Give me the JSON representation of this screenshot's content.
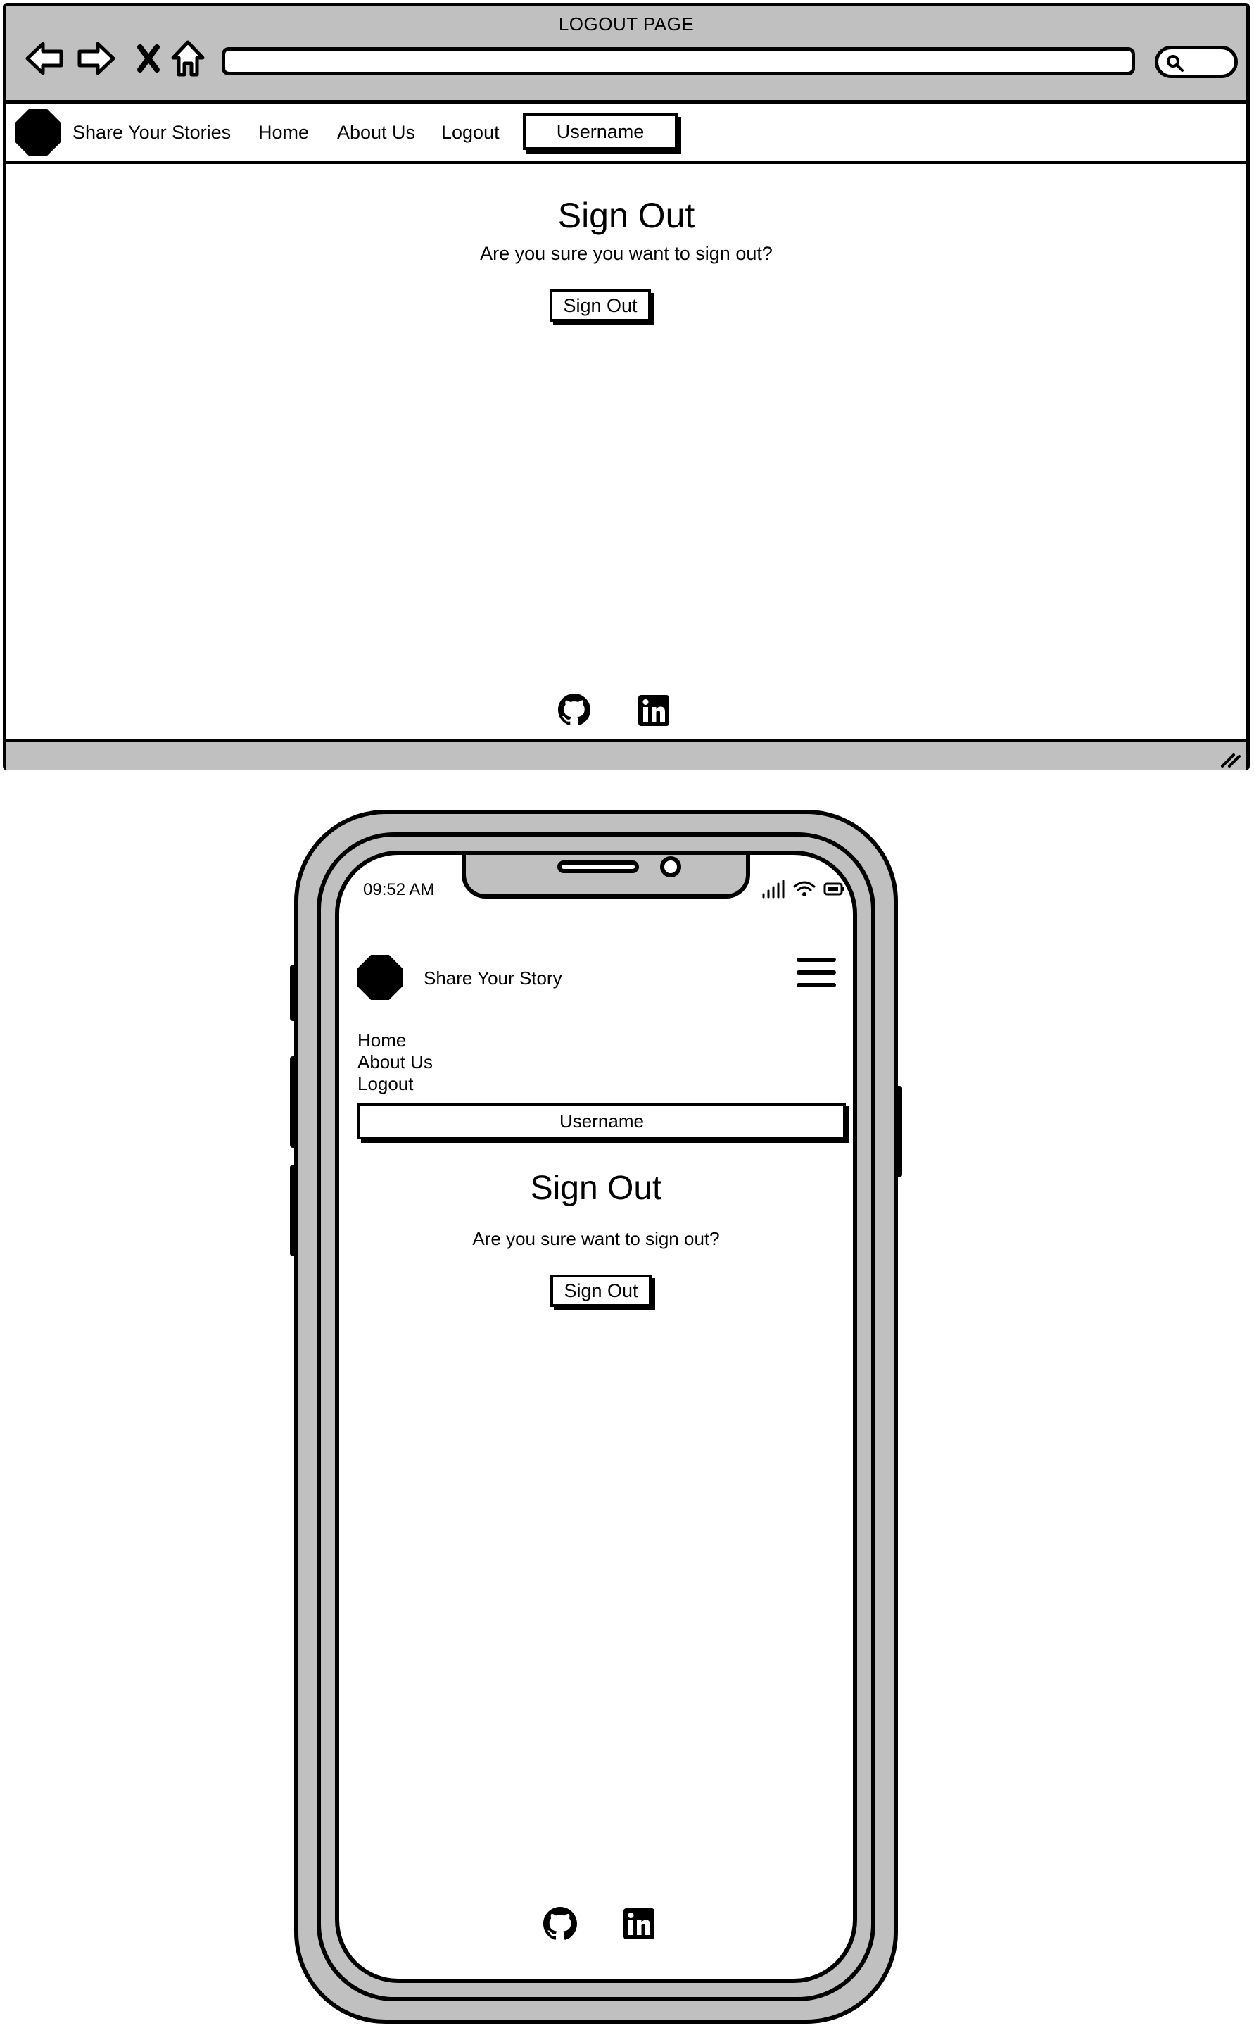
{
  "desktop": {
    "window_title": "LOGOUT PAGE",
    "nav": {
      "brand": "Share Your Stories",
      "links": [
        "Home",
        "About Us",
        "Logout"
      ],
      "user_button": "Username"
    },
    "main": {
      "title": "Sign Out",
      "question": "Are you sure you want to sign out?",
      "button": "Sign Out"
    },
    "footer_icons": [
      "github-icon",
      "linkedin-icon"
    ]
  },
  "mobile": {
    "status_time": "09:52 AM",
    "nav": {
      "brand": "Share Your Story",
      "links": [
        "Home",
        "About Us",
        "Logout"
      ],
      "user_button": "Username"
    },
    "main": {
      "title": "Sign Out",
      "question": "Are you sure want to sign out?",
      "button": "Sign Out"
    },
    "footer_icons": [
      "github-icon",
      "linkedin-icon"
    ]
  },
  "colors": {
    "chrome_gray": "#c0c0c0",
    "ink": "#000000",
    "paper": "#ffffff"
  }
}
